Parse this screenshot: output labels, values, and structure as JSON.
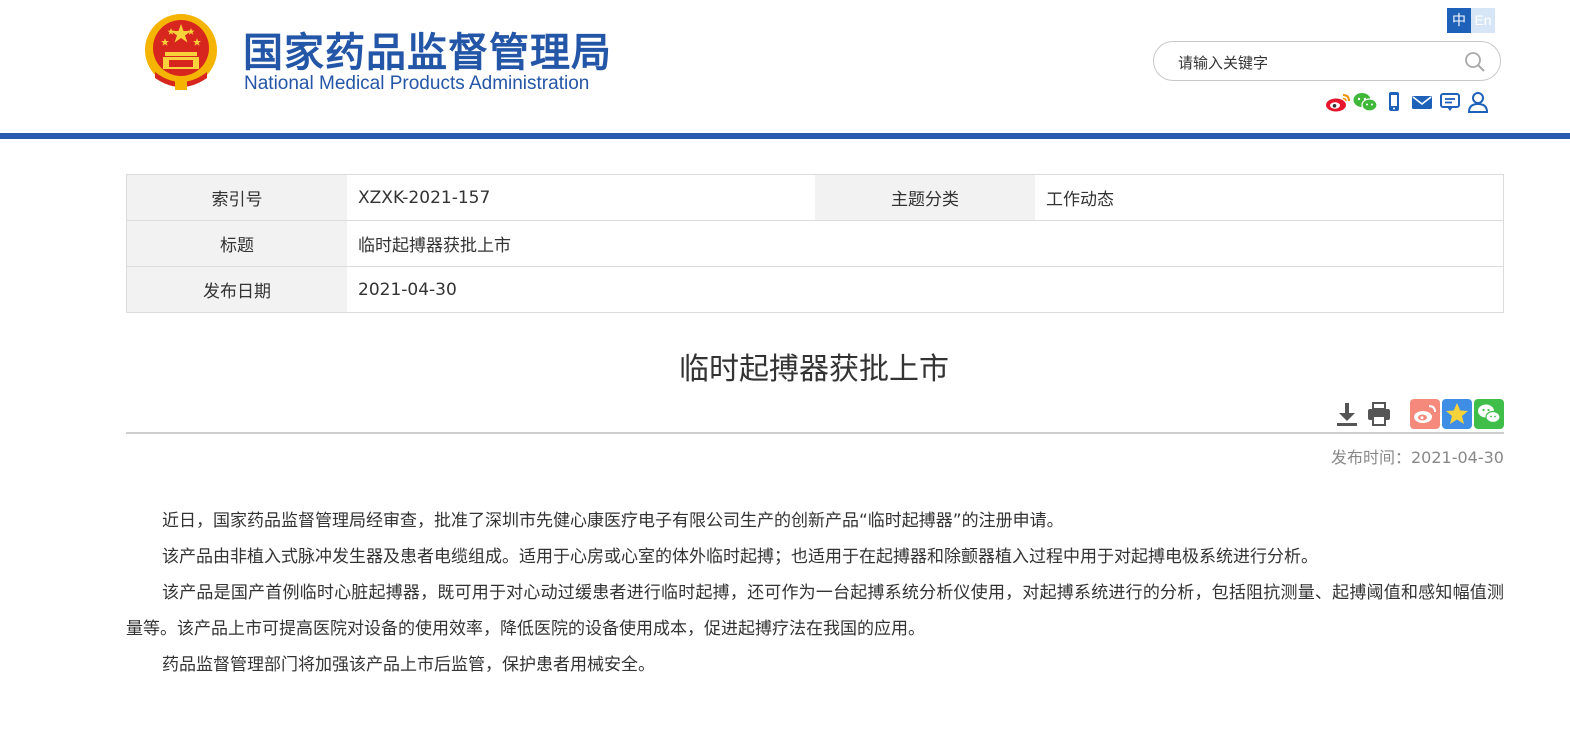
{
  "header": {
    "site_name_cn": "国家药品监督管理局",
    "site_name_en": "National Medical Products Administration",
    "lang_cn": "中",
    "lang_en": "En",
    "search_placeholder": "请输入关键字",
    "social_icons": [
      "weibo-icon",
      "wechat-icon",
      "mobile-icon",
      "mail-icon",
      "message-icon",
      "user-icon"
    ],
    "brand_color": "#2456a7",
    "rule_color": "#2a5ab0"
  },
  "meta": {
    "index_label": "索引号",
    "index_value": "XZXK-2021-157",
    "category_label": "主题分类",
    "category_value": "工作动态",
    "title_label": "标题",
    "title_value": "临时起搏器获批上市",
    "date_label": "发布日期",
    "date_value": "2021-04-30"
  },
  "article": {
    "title": "临时起搏器获批上市",
    "tools": [
      "download-icon",
      "print-icon",
      "share-weibo-icon",
      "share-qzone-icon",
      "share-wechat-icon"
    ],
    "publish_time": "发布时间：2021-04-30",
    "paragraphs": [
      "近日，国家药品监督管理局经审查，批准了深圳市先健心康医疗电子有限公司生产的创新产品“临时起搏器”的注册申请。",
      "该产品由非植入式脉冲发生器及患者电缆组成。适用于心房或心室的体外临时起搏；也适用于在起搏器和除颤器植入过程中用于对起搏电极系统进行分析。",
      "该产品是国产首例临时心脏起搏器，既可用于对心动过缓患者进行临时起搏，还可作为一台起搏系统分析仪使用，对起搏系统进行的分析，包括阻抗测量、起搏阈值和感知幅值测量等。该产品上市可提高医院对设备的使用效率，降低医院的设备使用成本，促进起搏疗法在我国的应用。",
      "药品监督管理部门将加强该产品上市后监管，保护患者用械安全。"
    ]
  }
}
